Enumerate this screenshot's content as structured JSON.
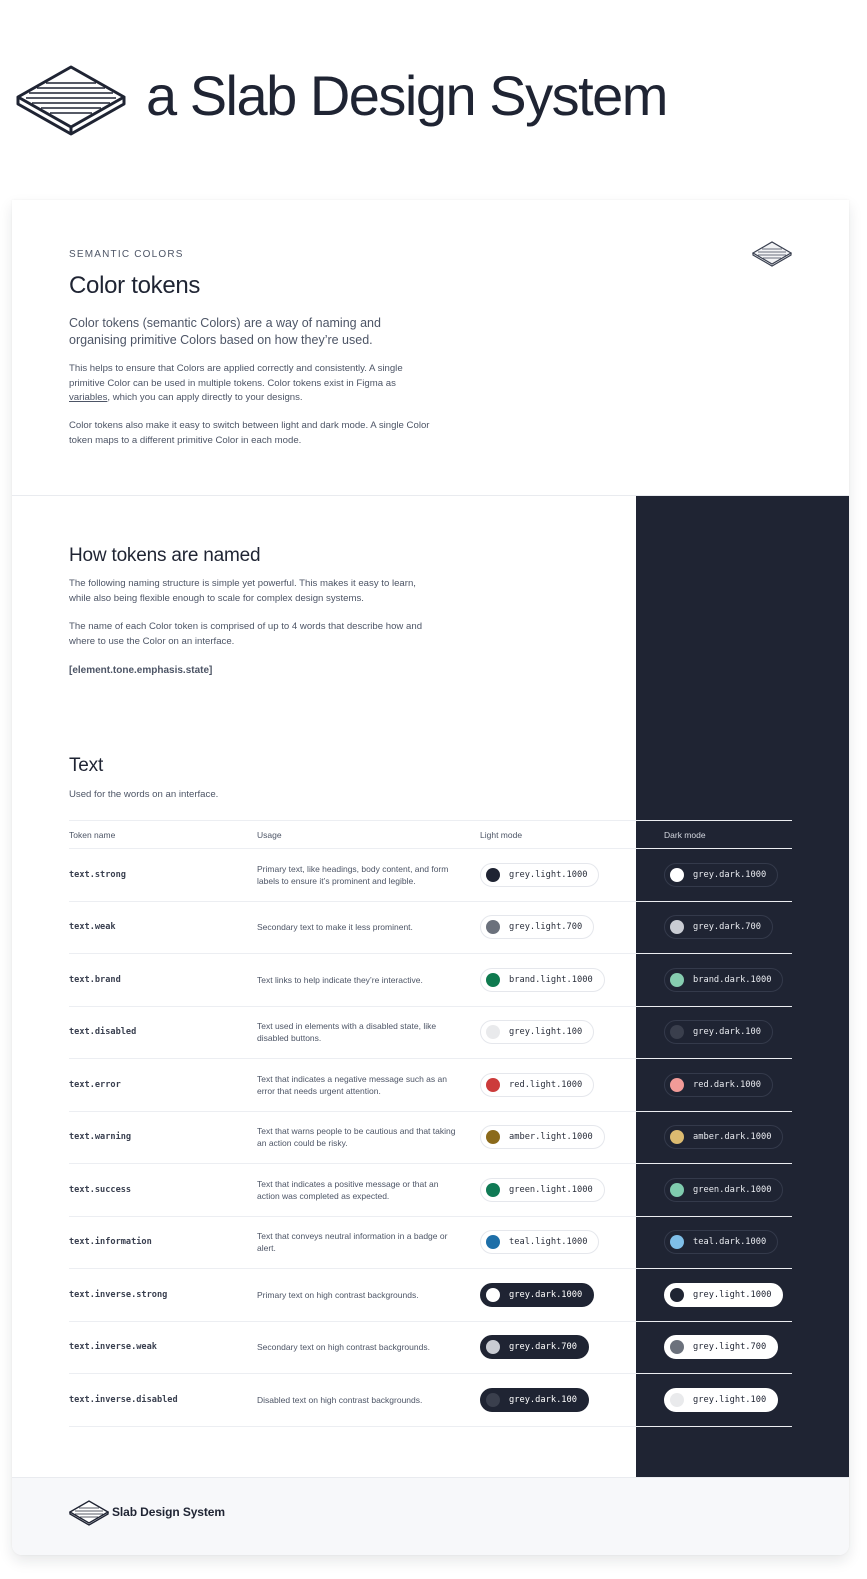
{
  "brand": {
    "title": "a Slab Design System",
    "footer_name": "Slab Design System"
  },
  "intro": {
    "eyebrow": "SEMANTIC COLORS",
    "title": "Color tokens",
    "lead": "Color tokens (semantic Colors) are a way of naming and organising primitive Colors based on how they’re used.",
    "para1_before": "This helps to ensure that Colors are applied correctly and consistently. A single primitive Color can be used in multiple tokens. Color tokens exist in Figma as ",
    "para1_link": "variables",
    "para1_after": ", which you can apply directly to your designs.",
    "para2": "Color tokens also make it easy to switch between light and dark mode. A single Color token maps to a different primitive Color in each mode."
  },
  "naming": {
    "title": "How tokens are named",
    "para1": "The following naming structure is simple yet powerful. This makes it easy to learn, while also being flexible enough to scale for complex design systems.",
    "para2": "The name of each Color token is comprised of up to 4 words that describe how and where to use the Color on an interface.",
    "structure": "[element.tone.emphasis.state]"
  },
  "text_section": {
    "title": "Text",
    "subtitle": "Used for the words on an interface."
  },
  "table": {
    "headers": {
      "token": "Token name",
      "usage": "Usage",
      "light": "Light mode",
      "dark": "Dark mode"
    },
    "rows": [
      {
        "token": "text.strong",
        "usage": "Primary text, like headings, body content, and form labels to ensure it’s prominent and legible.",
        "light": {
          "label": "grey.light.1000",
          "swatch": "#1f2433",
          "style": "light-outline"
        },
        "dark": {
          "label": "grey.dark.1000",
          "swatch": "#ffffff",
          "style": "dark-outline"
        }
      },
      {
        "token": "text.weak",
        "usage": "Secondary text to make it less prominent.",
        "light": {
          "label": "grey.light.700",
          "swatch": "#6b717c",
          "style": "light-outline"
        },
        "dark": {
          "label": "grey.dark.700",
          "swatch": "#c9ccd3",
          "style": "dark-outline"
        }
      },
      {
        "token": "text.brand",
        "usage": "Text links to help indicate they’re interactive.",
        "light": {
          "label": "brand.light.1000",
          "swatch": "#0f7a4f",
          "style": "light-outline"
        },
        "dark": {
          "label": "brand.dark.1000",
          "swatch": "#86cdb0",
          "style": "dark-outline"
        }
      },
      {
        "token": "text.disabled",
        "usage": "Text used in elements with a disabled state, like disabled buttons.",
        "light": {
          "label": "grey.light.100",
          "swatch": "#e9eaec",
          "style": "light-outline"
        },
        "dark": {
          "label": "grey.dark.100",
          "swatch": "#3a3f4d",
          "style": "dark-outline"
        }
      },
      {
        "token": "text.error",
        "usage": "Text that indicates a negative message such as an error that needs urgent attention.",
        "light": {
          "label": "red.light.1000",
          "swatch": "#cc3b3b",
          "style": "light-outline"
        },
        "dark": {
          "label": "red.dark.1000",
          "swatch": "#f29b98",
          "style": "dark-outline"
        }
      },
      {
        "token": "text.warning",
        "usage": "Text that warns people to be cautious and that taking an action could be risky.",
        "light": {
          "label": "amber.light.1000",
          "swatch": "#8b6a1b",
          "style": "light-outline"
        },
        "dark": {
          "label": "amber.dark.1000",
          "swatch": "#dcbb70",
          "style": "dark-outline"
        }
      },
      {
        "token": "text.success",
        "usage": "Text that indicates a positive message or that an action was completed as expected.",
        "light": {
          "label": "green.light.1000",
          "swatch": "#107a55",
          "style": "light-outline"
        },
        "dark": {
          "label": "green.dark.1000",
          "swatch": "#7fcbae",
          "style": "dark-outline"
        }
      },
      {
        "token": "text.information",
        "usage": "Text that conveys neutral information in a badge or alert.",
        "light": {
          "label": "teal.light.1000",
          "swatch": "#1e6fa8",
          "style": "light-outline"
        },
        "dark": {
          "label": "teal.dark.1000",
          "swatch": "#7fbfe8",
          "style": "dark-outline"
        }
      },
      {
        "token": "text.inverse.strong",
        "usage": "Primary text on high contrast backgrounds.",
        "light": {
          "label": "grey.dark.1000",
          "swatch": "#ffffff",
          "style": "dark-solid"
        },
        "dark": {
          "label": "grey.light.1000",
          "swatch": "#1f2433",
          "style": "white-solid"
        }
      },
      {
        "token": "text.inverse.weak",
        "usage": "Secondary text on high contrast backgrounds.",
        "light": {
          "label": "grey.dark.700",
          "swatch": "#c9ccd3",
          "style": "dark-solid"
        },
        "dark": {
          "label": "grey.light.700",
          "swatch": "#6b717c",
          "style": "white-solid"
        }
      },
      {
        "token": "text.inverse.disabled",
        "usage": "Disabled text on high contrast backgrounds.",
        "light": {
          "label": "grey.dark.100",
          "swatch": "#3a3f4d",
          "style": "dark-solid"
        },
        "dark": {
          "label": "grey.light.100",
          "swatch": "#e9eaec",
          "style": "white-solid"
        }
      }
    ]
  },
  "icons": {
    "logo": "slab-logo-icon"
  },
  "colors": {
    "ink": "#1f2433",
    "muted": "#4d5566",
    "dark_panel": "#1f2433"
  }
}
